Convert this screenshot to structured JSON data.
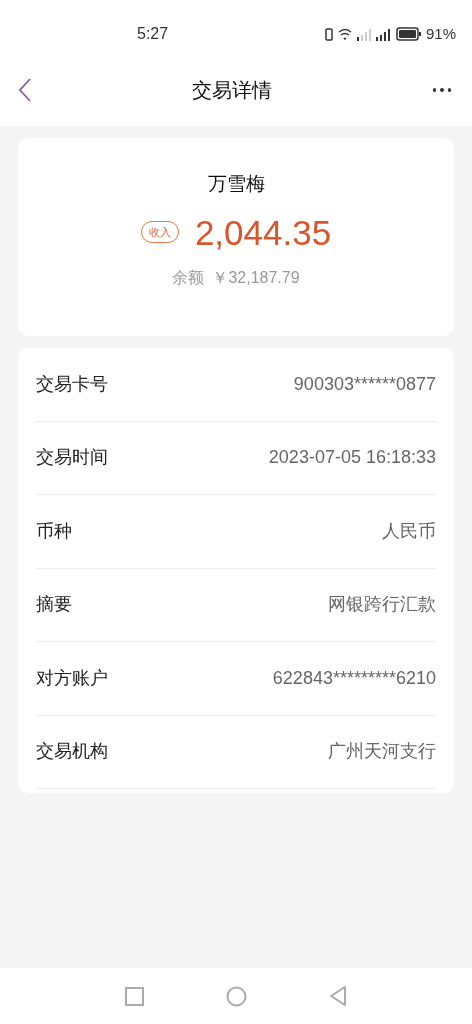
{
  "status_bar": {
    "time": "5:27",
    "battery": "91%"
  },
  "header": {
    "title": "交易详情"
  },
  "summary": {
    "name": "万雪梅",
    "tag": "收入",
    "amount": "2,044.35",
    "balance_label": "余额",
    "balance": "￥32,187.79"
  },
  "details": [
    {
      "label": "交易卡号",
      "value": "900303******0877"
    },
    {
      "label": "交易时间",
      "value": "2023-07-05 16:18:33"
    },
    {
      "label": "币种",
      "value": "人民币"
    },
    {
      "label": "摘要",
      "value": "网银跨行汇款"
    },
    {
      "label": "对方账户",
      "value": "622843*********6210"
    },
    {
      "label": "交易机构",
      "value": "广州天河支行"
    }
  ]
}
